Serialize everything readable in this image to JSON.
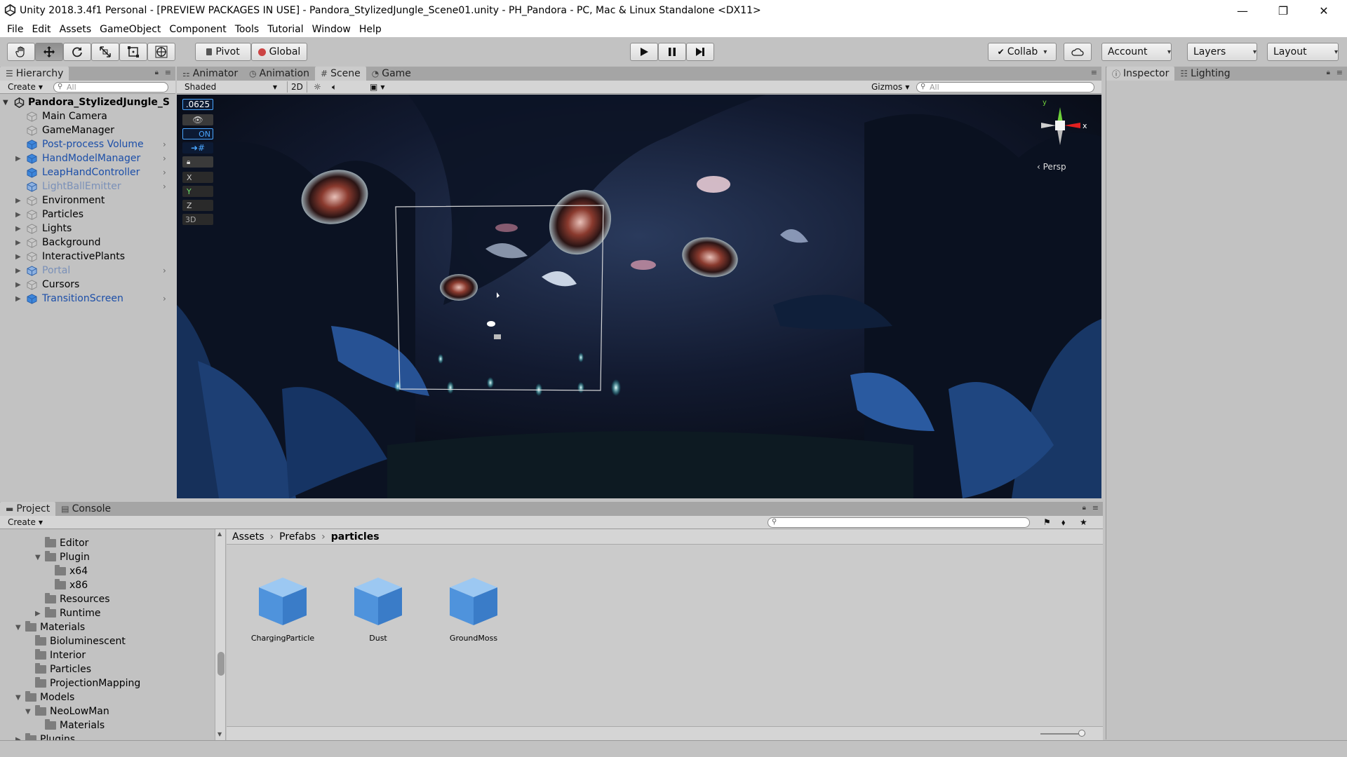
{
  "window": {
    "title": "Unity 2018.3.4f1 Personal - [PREVIEW PACKAGES IN USE] - Pandora_StylizedJungle_Scene01.unity - PH_Pandora - PC, Mac & Linux Standalone <DX11>",
    "minimize": "—",
    "maximize": "❐",
    "close": "✕"
  },
  "menu": [
    "File",
    "Edit",
    "Assets",
    "GameObject",
    "Component",
    "Tools",
    "Tutorial",
    "Window",
    "Help"
  ],
  "toolbar": {
    "pivot": "Pivot",
    "global": "Global",
    "collab": "Collab",
    "account": "Account",
    "layers": "Layers",
    "layout": "Layout"
  },
  "hierarchy": {
    "tab": "Hierarchy",
    "create": "Create",
    "search_placeholder": "All",
    "scene": "Pandora_StylizedJungle_S",
    "items": [
      {
        "label": "Main Camera",
        "style": "normal",
        "arrow": false,
        "chev": false
      },
      {
        "label": "GameManager",
        "style": "normal",
        "arrow": false,
        "chev": false
      },
      {
        "label": "Post-process Volume",
        "style": "prefab",
        "arrow": false,
        "chev": true
      },
      {
        "label": "HandModelManager",
        "style": "prefab",
        "arrow": true,
        "chev": true
      },
      {
        "label": "LeapHandController",
        "style": "prefab",
        "arrow": false,
        "chev": true
      },
      {
        "label": "LightBallEmitter",
        "style": "faded",
        "arrow": false,
        "chev": true
      },
      {
        "label": "Environment",
        "style": "normal",
        "arrow": true,
        "chev": false
      },
      {
        "label": "Particles",
        "style": "normal",
        "arrow": true,
        "chev": false
      },
      {
        "label": "Lights",
        "style": "normal",
        "arrow": true,
        "chev": false
      },
      {
        "label": "Background",
        "style": "normal",
        "arrow": true,
        "chev": false
      },
      {
        "label": "InteractivePlants",
        "style": "normal",
        "arrow": true,
        "chev": false
      },
      {
        "label": "Portal",
        "style": "faded",
        "arrow": true,
        "chev": true
      },
      {
        "label": "Cursors",
        "style": "normal",
        "arrow": true,
        "chev": false
      },
      {
        "label": "TransitionScreen",
        "style": "prefab",
        "arrow": true,
        "chev": true
      }
    ]
  },
  "scene_tabs": {
    "animator": "Animator",
    "animation": "Animation",
    "scene": "Scene",
    "game": "Game"
  },
  "scene_bar": {
    "shading": "Shaded",
    "twod": "2D",
    "gizmos": "Gizmos",
    "search_placeholder": "All",
    "persp": "Persp",
    "snap_value": ".0625",
    "on_label": "ON",
    "axis_x": "X",
    "axis_y": "Y",
    "axis_z": "Z",
    "threed": "3D",
    "gizmo_x": "x",
    "gizmo_y": "y"
  },
  "inspector": {
    "tab": "Inspector",
    "lighting": "Lighting"
  },
  "project": {
    "tab": "Project",
    "console": "Console",
    "create": "Create",
    "breadcrumb": [
      "Assets",
      "Prefabs",
      "particles"
    ],
    "tree": [
      {
        "label": "Editor",
        "indent": 2,
        "arrow": ""
      },
      {
        "label": "Plugin",
        "indent": 2,
        "arrow": "▼"
      },
      {
        "label": "x64",
        "indent": 3,
        "arrow": ""
      },
      {
        "label": "x86",
        "indent": 3,
        "arrow": ""
      },
      {
        "label": "Resources",
        "indent": 2,
        "arrow": ""
      },
      {
        "label": "Runtime",
        "indent": 2,
        "arrow": "▶"
      },
      {
        "label": "Materials",
        "indent": 0,
        "arrow": "▼"
      },
      {
        "label": "Bioluminescent",
        "indent": 1,
        "arrow": ""
      },
      {
        "label": "Interior",
        "indent": 1,
        "arrow": ""
      },
      {
        "label": "Particles",
        "indent": 1,
        "arrow": ""
      },
      {
        "label": "ProjectionMapping",
        "indent": 1,
        "arrow": ""
      },
      {
        "label": "Models",
        "indent": 0,
        "arrow": "▼"
      },
      {
        "label": "NeoLowMan",
        "indent": 1,
        "arrow": "▼"
      },
      {
        "label": "Materials",
        "indent": 2,
        "arrow": ""
      },
      {
        "label": "Plugins",
        "indent": 0,
        "arrow": "▶"
      }
    ],
    "assets": [
      "ChargingParticle",
      "Dust",
      "GroundMoss"
    ]
  }
}
